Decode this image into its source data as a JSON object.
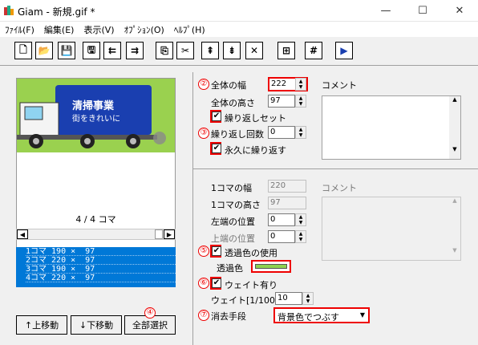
{
  "window": {
    "title": "Giam - 新規.gif *",
    "minimize": "—",
    "maximize": "☐",
    "close": "✕"
  },
  "menu": [
    "ﾌｧｲﾙ(F)",
    "編集(E)",
    "表示(V)",
    "ｵﾌﾟｼｮﾝ(O)",
    "ﾍﾙﾌﾟ(H)"
  ],
  "toolbar": {
    "icons": [
      "new-file-icon",
      "open-folder-icon",
      "save-icon",
      "save-as-icon",
      "import-frame-icon",
      "export-frame-icon",
      "copy-icon",
      "cut-icon",
      "paste-before-icon",
      "paste-after-icon",
      "delete-icon",
      "align-icon",
      "grid-icon",
      "play-icon"
    ],
    "glyphs": [
      "🗋",
      "📂",
      "💾",
      "🖫",
      "⇇",
      "⇉",
      "⎘",
      "✂",
      "⇞",
      "⇟",
      "✕",
      "⊞",
      "#",
      "▶"
    ]
  },
  "preview": {
    "banner_text": "清掃事業",
    "sub_text": "街をきれいに",
    "bg_color": "#9ad14f",
    "frame_label": "4 / 4 コマ"
  },
  "frames": [
    "1コマ 190 ×  97",
    "2コマ 220 ×  97",
    "3コマ 190 ×  97",
    "4コマ 220 ×  97"
  ],
  "buttons": {
    "up": "↑上移動",
    "down": "↓下移動",
    "select_all": "全部選択"
  },
  "global": {
    "width_label": "全体の幅",
    "width_value": "222",
    "height_label": "全体の高さ",
    "height_value": "97",
    "loop_set_label": "繰り返しセット",
    "loop_count_label": "繰り返し回数",
    "loop_count_value": "0",
    "forever_label": "永久に繰り返す",
    "comment_label": "コメント"
  },
  "frame": {
    "width_label": "1コマの幅",
    "width_value": "220",
    "height_label": "1コマの高さ",
    "height_value": "97",
    "left_label": "左端の位置",
    "left_value": "0",
    "top_label": "上端の位置",
    "top_value": "0",
    "comment_label": "コメント",
    "transparent_label": "透過色の使用",
    "transparent_color_label": "透過色",
    "transparent_color": "#8fd14f",
    "wait_label": "ウェイト有り",
    "wait_time_label": "ウェイト[1/100s]",
    "wait_value": "10",
    "dispose_label": "消去手段",
    "dispose_value": "背景色でつぶす"
  },
  "markers": [
    "②",
    "③",
    "④",
    "⑤",
    "⑥",
    "⑦"
  ]
}
